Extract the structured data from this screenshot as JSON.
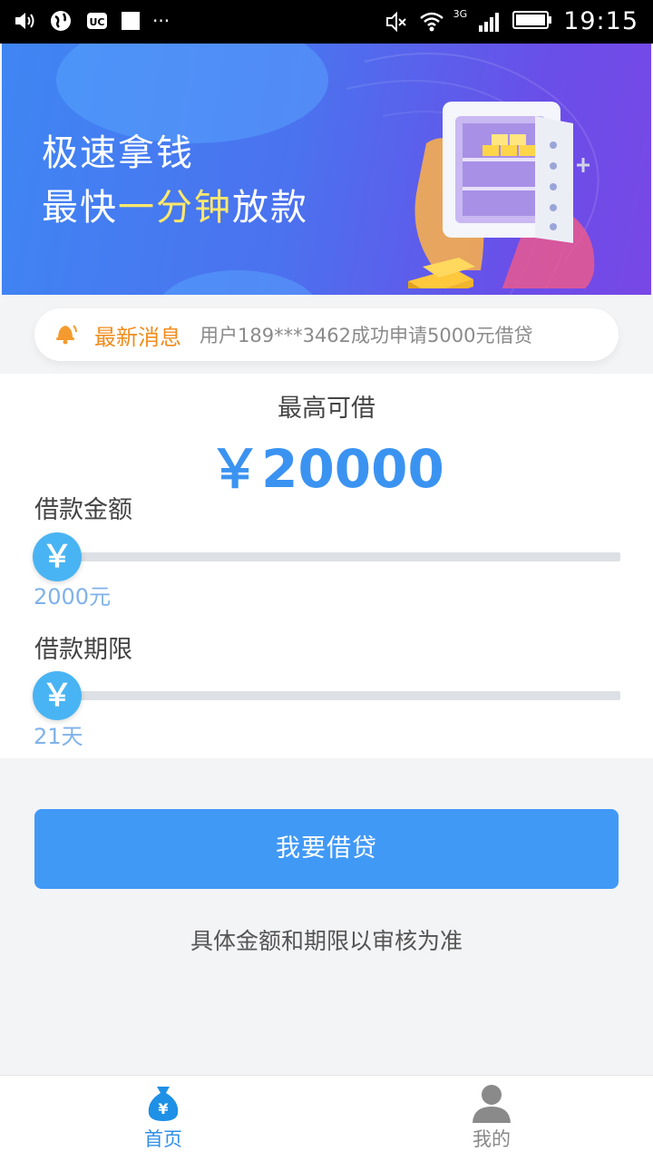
{
  "status_bar": {
    "time": "19:15",
    "network": "3G",
    "icons": [
      "volume-icon",
      "globe-icon",
      "notification-app-icon",
      "square-icon",
      "more-dots-icon",
      "mute-icon",
      "wifi-icon",
      "signal-icon",
      "battery-icon"
    ],
    "dots": "···"
  },
  "banner": {
    "line1": "极速拿钱",
    "line2_prefix": "最快",
    "line2_highlight": "一分钟",
    "line2_suffix": "放款",
    "highlight_color": "#ffe86b"
  },
  "notice": {
    "icon": "bell-icon",
    "title": "最新消息",
    "text": "用户189***3462成功申请5000元借贷"
  },
  "loan": {
    "max_label": "最高可借",
    "max_amount": "￥20000",
    "amount_label": "借款金额",
    "amount_value": "2000元",
    "amount_knob": "￥",
    "term_label": "借款期限",
    "term_value": "21天",
    "term_knob": "￥"
  },
  "actions": {
    "apply_button": "我要借贷",
    "hint": "具体金额和期限以审核为准"
  },
  "bottom_nav": {
    "items": [
      {
        "label": "首页",
        "icon": "money-bag-icon",
        "active": true
      },
      {
        "label": "我的",
        "icon": "user-icon",
        "active": false
      }
    ]
  },
  "colors": {
    "accent": "#4199f6",
    "amount": "#3b93f1",
    "notice_title": "#f08c1e",
    "knob": "#49b4f3"
  }
}
